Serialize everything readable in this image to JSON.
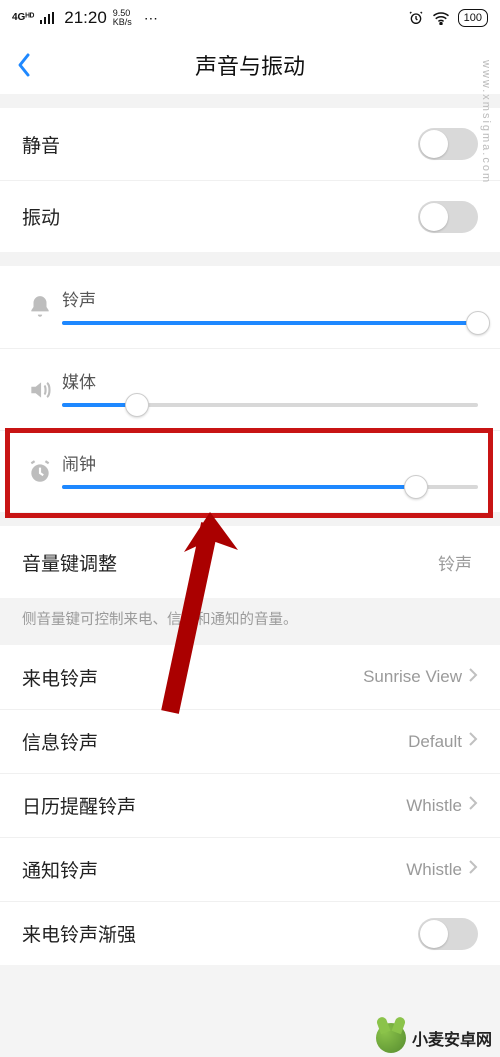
{
  "status": {
    "net": "4Gᴴᴰ",
    "time": "21:20",
    "kbps_top": "9.50",
    "kbps_bot": "KB/s",
    "dots": "⋯",
    "battery": "100"
  },
  "header": {
    "title": "声音与振动"
  },
  "toggles": {
    "mute_label": "静音",
    "mute_on": false,
    "vibrate_label": "振动",
    "vibrate_on": false
  },
  "sliders": {
    "ringtone": {
      "label": "铃声",
      "value": 100
    },
    "media": {
      "label": "媒体",
      "value": 18
    },
    "alarm": {
      "label": "闹钟",
      "value": 85
    }
  },
  "volume_key": {
    "label": "音量键调整",
    "value": "铃声",
    "desc": "侧音量键可控制来电、信息和通知的音量。"
  },
  "rows": {
    "incoming": {
      "label": "来电铃声",
      "value": "Sunrise View"
    },
    "message": {
      "label": "信息铃声",
      "value": "Default"
    },
    "calendar": {
      "label": "日历提醒铃声",
      "value": "Whistle"
    },
    "notify": {
      "label": "通知铃声",
      "value": "Whistle"
    },
    "ascending": {
      "label": "来电铃声渐强"
    }
  },
  "watermark": {
    "url": "www.xmsigma.com",
    "brand": "小麦安卓网"
  }
}
